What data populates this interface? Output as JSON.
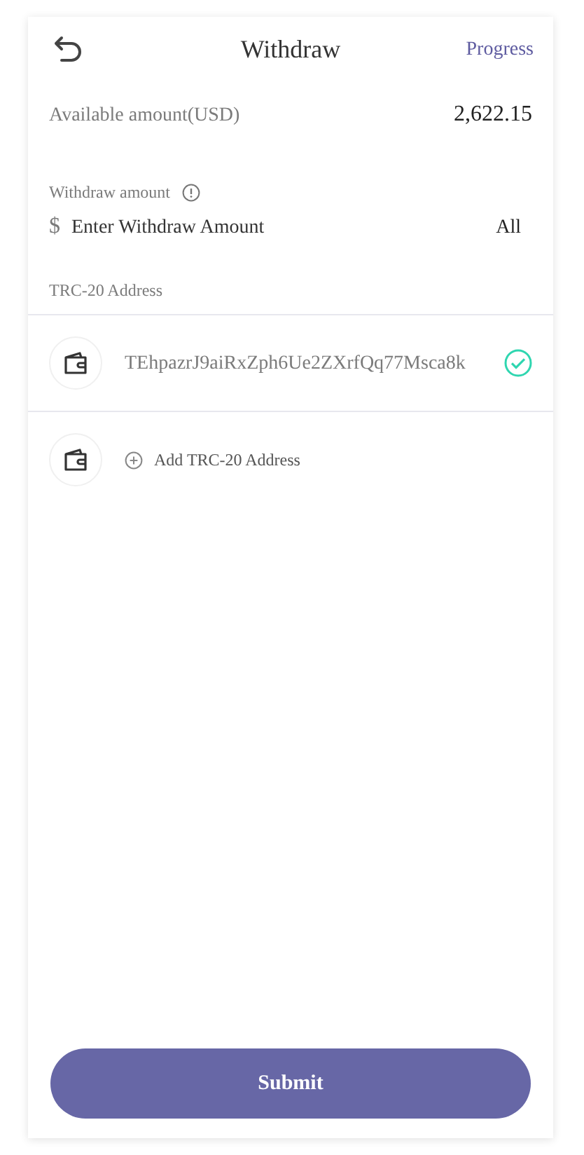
{
  "header": {
    "title": "Withdraw",
    "action": "Progress"
  },
  "available": {
    "label": "Available amount(USD)",
    "value": "2,622.15"
  },
  "withdraw_amount": {
    "label": "Withdraw amount",
    "currency": "$",
    "placeholder": "Enter Withdraw Amount",
    "all_button": "All"
  },
  "address_section": {
    "label": "TRC-20 Address"
  },
  "addresses": [
    {
      "address": "TEhpazrJ9aiRxZph6Ue2ZXrfQq77Msca8k",
      "selected": true
    }
  ],
  "add_address": {
    "label": "Add TRC-20 Address"
  },
  "submit": {
    "label": "Submit"
  }
}
